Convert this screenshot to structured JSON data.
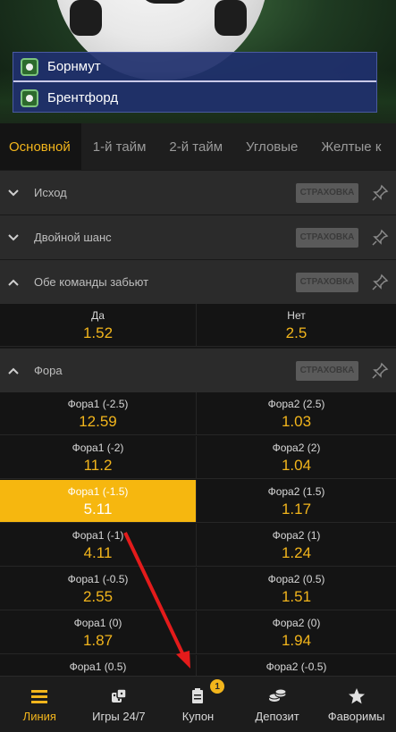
{
  "match": {
    "team1": "Борнмут",
    "team2": "Брентфорд"
  },
  "tabs": [
    "Основной",
    "1-й тайм",
    "2-й тайм",
    "Угловые",
    "Желтые к"
  ],
  "markets": [
    {
      "title": "Исход",
      "insurance": "СТРАХОВКА",
      "expanded": false
    },
    {
      "title": "Двойной шанс",
      "insurance": "СТРАХОВКА",
      "expanded": false
    },
    {
      "title": "Обе команды забьют",
      "insurance": "СТРАХОВКА",
      "expanded": true
    },
    {
      "title": "Фора",
      "insurance": "СТРАХОВКА",
      "expanded": true
    }
  ],
  "btts": [
    {
      "label": "Да",
      "odd": "1.52"
    },
    {
      "label": "Нет",
      "odd": "2.5"
    }
  ],
  "handicap": [
    {
      "left": {
        "label": "Фора1 (-2.5)",
        "odd": "12.59"
      },
      "right": {
        "label": "Фора2 (2.5)",
        "odd": "1.03"
      }
    },
    {
      "left": {
        "label": "Фора1 (-2)",
        "odd": "11.2"
      },
      "right": {
        "label": "Фора2 (2)",
        "odd": "1.04"
      }
    },
    {
      "left": {
        "label": "Фора1 (-1.5)",
        "odd": "5.11"
      },
      "right": {
        "label": "Фора2 (1.5)",
        "odd": "1.17"
      }
    },
    {
      "left": {
        "label": "Фора1 (-1)",
        "odd": "4.11"
      },
      "right": {
        "label": "Фора2 (1)",
        "odd": "1.24"
      }
    },
    {
      "left": {
        "label": "Фора1 (-0.5)",
        "odd": "2.55"
      },
      "right": {
        "label": "Фора2 (0.5)",
        "odd": "1.51"
      }
    },
    {
      "left": {
        "label": "Фора1 (0)",
        "odd": "1.87"
      },
      "right": {
        "label": "Фора2 (0)",
        "odd": "1.94"
      }
    },
    {
      "left": {
        "label": "Фора1 (0.5)",
        "odd": ""
      },
      "right": {
        "label": "Фора2 (-0.5)",
        "odd": ""
      }
    }
  ],
  "selected_cell": "Фора1 (-1.5)",
  "nav": [
    {
      "label": "Линия",
      "icon": "lines-icon",
      "active": true
    },
    {
      "label": "Игры 24/7",
      "icon": "dice-icon",
      "active": false
    },
    {
      "label": "Купон",
      "icon": "coupon-icon",
      "active": false,
      "badge": "1"
    },
    {
      "label": "Депозит",
      "icon": "coins-icon",
      "active": false
    },
    {
      "label": "Фаворимы",
      "icon": "star-icon",
      "active": false
    }
  ],
  "colors": {
    "accent": "#f2b51c",
    "background": "#141414",
    "market_bar": "#2b2b2b",
    "match_box": "#20306e",
    "arrow": "#e41b1b"
  }
}
